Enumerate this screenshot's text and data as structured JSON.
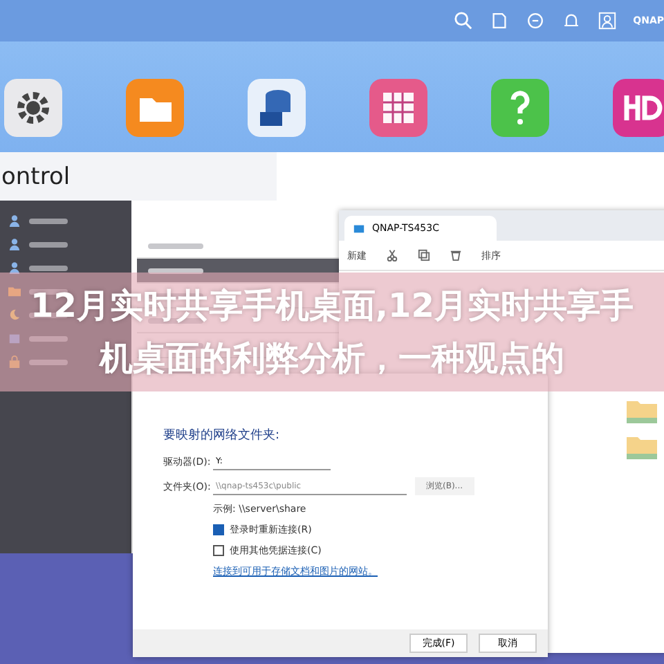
{
  "topbar": {
    "user": "QNAP"
  },
  "apps": [
    {
      "kind": "gear"
    },
    {
      "kind": "folder"
    },
    {
      "kind": "storage"
    },
    {
      "kind": "grid"
    },
    {
      "kind": "help"
    },
    {
      "kind": "hd"
    }
  ],
  "control_window": {
    "title": "ontrol",
    "sidebar": [
      {
        "kind": "user"
      },
      {
        "kind": "user"
      },
      {
        "kind": "user"
      },
      {
        "kind": "folder"
      },
      {
        "kind": "moon"
      },
      {
        "kind": "box"
      },
      {
        "kind": "lock"
      }
    ]
  },
  "explorer": {
    "tab": "QNAP-TS453C",
    "new_button": "新建",
    "sort_button": "排序"
  },
  "dialog": {
    "heading": "要映射的网络文件夹:",
    "drive_label": "驱动器(D):",
    "drive_value": "Y:",
    "folder_label": "文件夹(O):",
    "folder_value": "\\\\qnap-ts453c\\public",
    "browse": "浏览(B)...",
    "example": "示例: \\\\server\\share",
    "options": [
      {
        "label": "登录时重新连接(R)",
        "checked": true
      },
      {
        "label": "使用其他凭据连接(C)",
        "checked": false
      }
    ],
    "link": "连接到可用于存储文档和图片的网站。",
    "buttons": [
      {
        "label": "完成(F)"
      },
      {
        "label": "取消"
      }
    ]
  },
  "banner": {
    "title": "12月实时共享手机桌面,12月实时共享手机桌面的利弊分析，一种观点的"
  }
}
